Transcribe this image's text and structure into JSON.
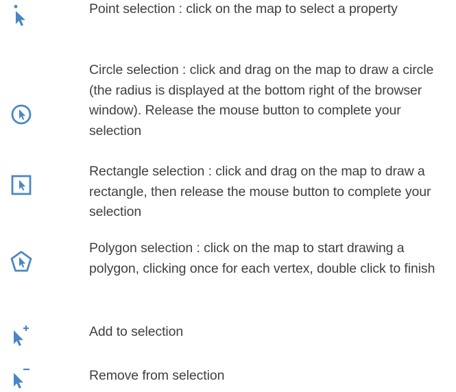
{
  "legend": {
    "items": [
      {
        "icon": "point-selection-icon",
        "text": "Point selection : click on the map to select a property"
      },
      {
        "icon": "circle-selection-icon",
        "text": "Circle selection : click and drag on the map to draw a circle (the radius is displayed at the bottom right of the browser window).  Release the mouse button to complete your selection"
      },
      {
        "icon": "rectangle-selection-icon",
        "text": "Rectangle selection : click and drag on the map to draw a rectangle, then release the mouse button to complete your selection"
      },
      {
        "icon": "polygon-selection-icon",
        "text": "Polygon selection : click on the map to start drawing a polygon, clicking once for each vertex, double click to finish"
      },
      {
        "icon": "add-to-selection-icon",
        "text": "Add to selection"
      },
      {
        "icon": "remove-from-selection-icon",
        "text": "Remove from selection"
      }
    ]
  },
  "colors": {
    "icon_blue": "#4a86c5",
    "text": "#404040"
  }
}
